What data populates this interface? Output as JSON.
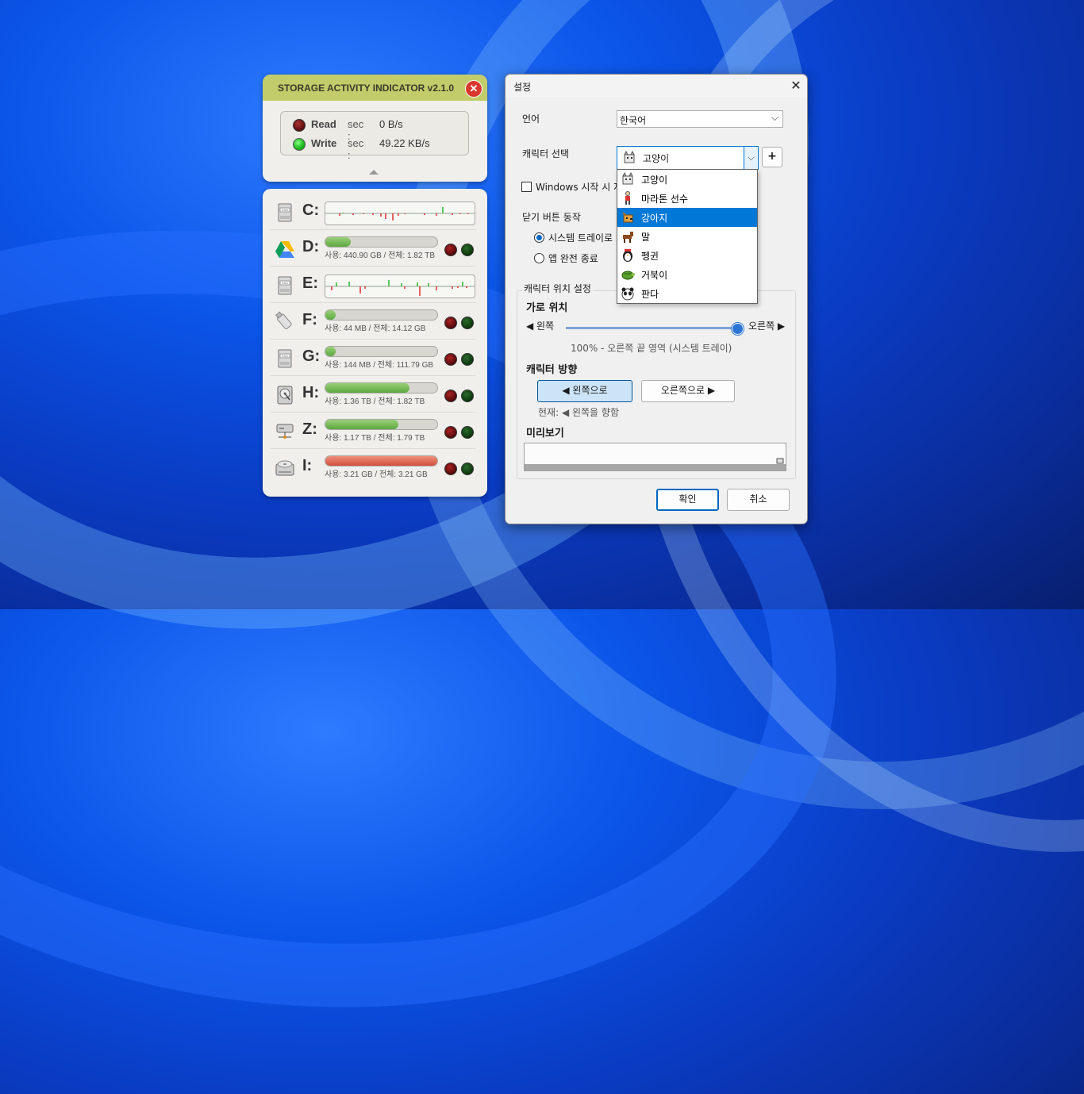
{
  "storage_widget": {
    "title": "STORAGE ACTIVITY INDICATOR  v2.1.0",
    "close_glyph": "✕",
    "read": {
      "label": "Read",
      "sec_label": "sec :",
      "value": "0 B/s"
    },
    "write": {
      "label": "Write",
      "sec_label": "sec :",
      "value": "49.22 KB/s"
    },
    "drives": [
      {
        "letter": "C:",
        "icon": "ssd-icon",
        "mode": "graph"
      },
      {
        "letter": "D:",
        "icon": "google-drive-icon",
        "mode": "bar",
        "usage": "사용: 440.90 GB / 전체: 1.82 TB",
        "fill_fraction": 0.23,
        "bar_color": "green"
      },
      {
        "letter": "E:",
        "icon": "ssd-icon",
        "mode": "graph"
      },
      {
        "letter": "F:",
        "icon": "usb-drive-icon",
        "mode": "bar",
        "usage": "사용: 44 MB / 전체: 14.12 GB",
        "fill_fraction": 0.09,
        "bar_color": "green"
      },
      {
        "letter": "G:",
        "icon": "ssd-icon",
        "mode": "bar",
        "usage": "사용: 144 MB / 전체: 111.79 GB",
        "fill_fraction": 0.09,
        "bar_color": "green"
      },
      {
        "letter": "H:",
        "icon": "hard-disk-icon",
        "mode": "bar",
        "usage": "사용: 1.36 TB / 전체: 1.82 TB",
        "fill_fraction": 0.75,
        "bar_color": "green"
      },
      {
        "letter": "Z:",
        "icon": "network-drive-icon",
        "mode": "bar",
        "usage": "사용: 1.17 TB / 전체: 1.79 TB",
        "fill_fraction": 0.65,
        "bar_color": "green"
      },
      {
        "letter": "I:",
        "icon": "optical-drive-icon",
        "mode": "bar",
        "usage": "사용: 3.21 GB / 전체: 3.21 GB",
        "fill_fraction": 1.0,
        "bar_color": "red"
      }
    ]
  },
  "settings": {
    "title": "설정",
    "close_glyph": "✕",
    "language_label": "언어",
    "language_value": "한국어",
    "character_label": "캐릭터 선택",
    "character_value": "고양이",
    "plus_label": "+",
    "windows_start_label": "Windows 시작 시 자",
    "close_action_label": "닫기 버튼 동작",
    "close_options": [
      "시스템 트레이로",
      "앱 완전 종료"
    ],
    "position_group_label": "캐릭터 위치 설정",
    "horizontal_label": "가로 위치",
    "left_label": "◀ 왼쪽",
    "right_label": "오른쪽 ▶",
    "horizontal_value_text": "100% - 오른쪽 끝 영역 (시스템 트레이)",
    "horizontal_percent": 100,
    "direction_label": "캐릭터 방향",
    "dir_left_button": "◀ 왼쪽으로",
    "dir_right_button": "오른쪽으로 ▶",
    "current_direction": "현재: ◀ 왼쪽을 향함",
    "preview_label": "미리보기",
    "ok_button": "확인",
    "cancel_button": "취소"
  },
  "character_dropdown": {
    "items": [
      {
        "label": "고양이",
        "icon": "cat-icon"
      },
      {
        "label": "마라톤 선수",
        "icon": "runner-icon"
      },
      {
        "label": "강아지",
        "icon": "dog-icon",
        "highlighted": true
      },
      {
        "label": "말",
        "icon": "horse-icon"
      },
      {
        "label": "펭귄",
        "icon": "penguin-icon"
      },
      {
        "label": "거북이",
        "icon": "turtle-icon"
      },
      {
        "label": "판다",
        "icon": "panda-icon"
      }
    ]
  },
  "colors": {
    "widget_header": "#c2cc6a",
    "accent_blue": "#0078d7",
    "led_green": "#16b516",
    "bar_green": "#5da83f",
    "bar_red": "#d24f3c"
  }
}
